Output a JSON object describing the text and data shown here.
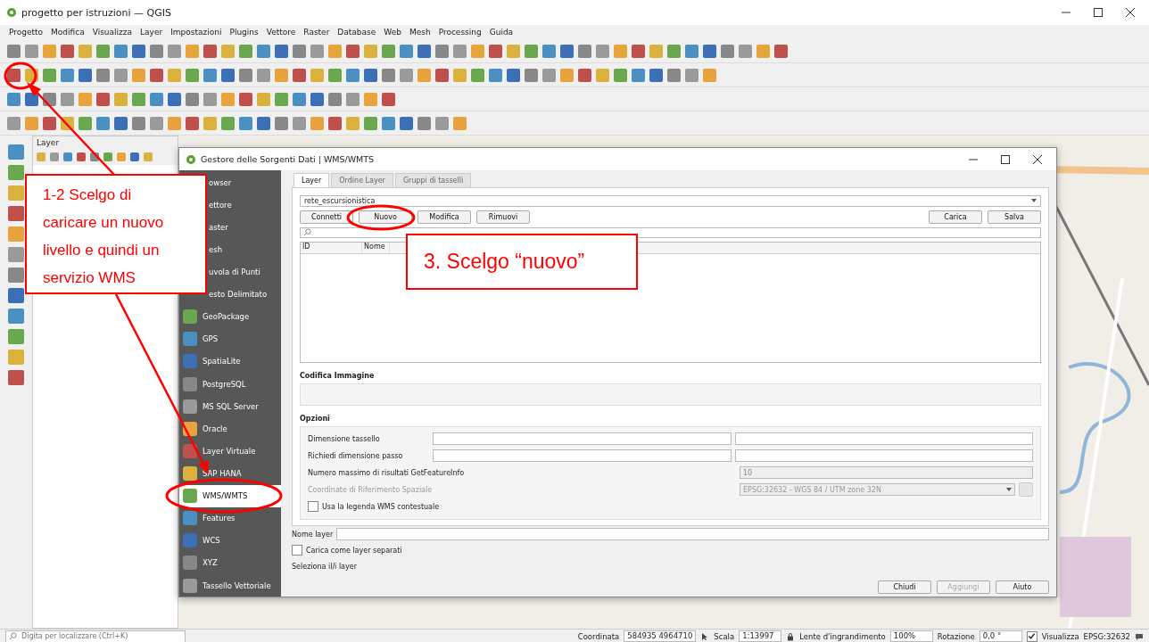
{
  "window": {
    "title": "progetto per istruzioni — QGIS"
  },
  "menu": [
    "Progetto",
    "Modifica",
    "Visualizza",
    "Layer",
    "Impostazioni",
    "Plugins",
    "Vettore",
    "Raster",
    "Database",
    "Web",
    "Mesh",
    "Processing",
    "Guida"
  ],
  "layers_panel": {
    "title": "Layer"
  },
  "dialog": {
    "title": "Gestore delle Sorgenti Dati | WMS/WMTS",
    "sidebar": [
      {
        "label": "owser",
        "kind": "covered",
        "selected": false
      },
      {
        "label": "ettore",
        "kind": "covered",
        "selected": false
      },
      {
        "label": "aster",
        "kind": "covered",
        "selected": false
      },
      {
        "label": "esh",
        "kind": "covered",
        "selected": false
      },
      {
        "label": "uvola di Punti",
        "kind": "covered",
        "selected": false
      },
      {
        "label": "esto Delimitato",
        "kind": "covered",
        "selected": false
      },
      {
        "label": "GeoPackage",
        "kind": "full",
        "selected": false
      },
      {
        "label": "GPS",
        "kind": "full",
        "selected": false
      },
      {
        "label": "SpatiaLite",
        "kind": "full",
        "selected": false
      },
      {
        "label": "PostgreSQL",
        "kind": "full",
        "selected": false
      },
      {
        "label": "MS SQL Server",
        "kind": "full",
        "selected": false
      },
      {
        "label": "Oracle",
        "kind": "full",
        "selected": false
      },
      {
        "label": "Layer Virtuale",
        "kind": "full",
        "selected": false
      },
      {
        "label": "SAP HANA",
        "kind": "full",
        "selected": false
      },
      {
        "label": "WMS/WMTS",
        "kind": "full",
        "selected": true
      },
      {
        "label": "Features",
        "kind": "full",
        "selected": false
      },
      {
        "label": "WCS",
        "kind": "full",
        "selected": false
      },
      {
        "label": "XYZ",
        "kind": "full",
        "selected": false
      },
      {
        "label": "Tassello Vettoriale",
        "kind": "full",
        "selected": false
      }
    ],
    "tabs": [
      {
        "label": "Layer",
        "selected": true
      },
      {
        "label": "Ordine Layer",
        "selected": false
      },
      {
        "label": "Gruppi di tasselli",
        "selected": false
      }
    ],
    "connection": "rete_escursionistica",
    "buttons_left": [
      "Connetti",
      "Nuovo",
      "Modifica",
      "Rimuovi"
    ],
    "buttons_right": [
      "Carica",
      "Salva"
    ],
    "table": {
      "columns": [
        "ID",
        "Nome"
      ]
    },
    "image_encoding": {
      "title": "Codifica Immagine"
    },
    "options": {
      "title": "Opzioni",
      "tile_size": "Dimensione tassello",
      "step": "Richiedi dimensione passo",
      "max_label": "Numero massimo di risultati GetFeatureInfo",
      "max_value": "10",
      "crs": {
        "label": "Coordinate di Riferimento Spaziale",
        "value": "EPSG:32632 - WGS 84 / UTM zone 32N",
        "disabled": true
      },
      "legend": {
        "label": "Usa la legenda WMS contestuale",
        "checked": false
      }
    },
    "layer_name_label": "Nome layer",
    "separate": {
      "label": "Carica come layer separati",
      "checked": false
    },
    "select_label": "Seleziona il/i layer",
    "footer_buttons": [
      {
        "label": "Chiudi",
        "disabled": false
      },
      {
        "label": "Aggiungi",
        "disabled": true
      },
      {
        "label": "Aiuto",
        "disabled": false
      }
    ]
  },
  "status_bar": {
    "search_placeholder": "Digita per localizzare (Ctrl+K)",
    "coord_label": "Coordinata",
    "coord": "584935 4964710",
    "scale_label": "Scala",
    "scale": "1:13997",
    "magnifier_label": "Lente d'ingrandimento",
    "magnifier": "100%",
    "rotation_label": "Rotazione",
    "rotation": "0,0 °",
    "render": {
      "label": "Visualizza",
      "checked": true
    },
    "crs": "EPSG:32632"
  },
  "annotations": [
    {
      "text": "1-2 Scelgo di caricare un nuovo livello e quindi un servizio WMS"
    },
    {
      "text": "3. Scelgo “nuovo”"
    }
  ]
}
